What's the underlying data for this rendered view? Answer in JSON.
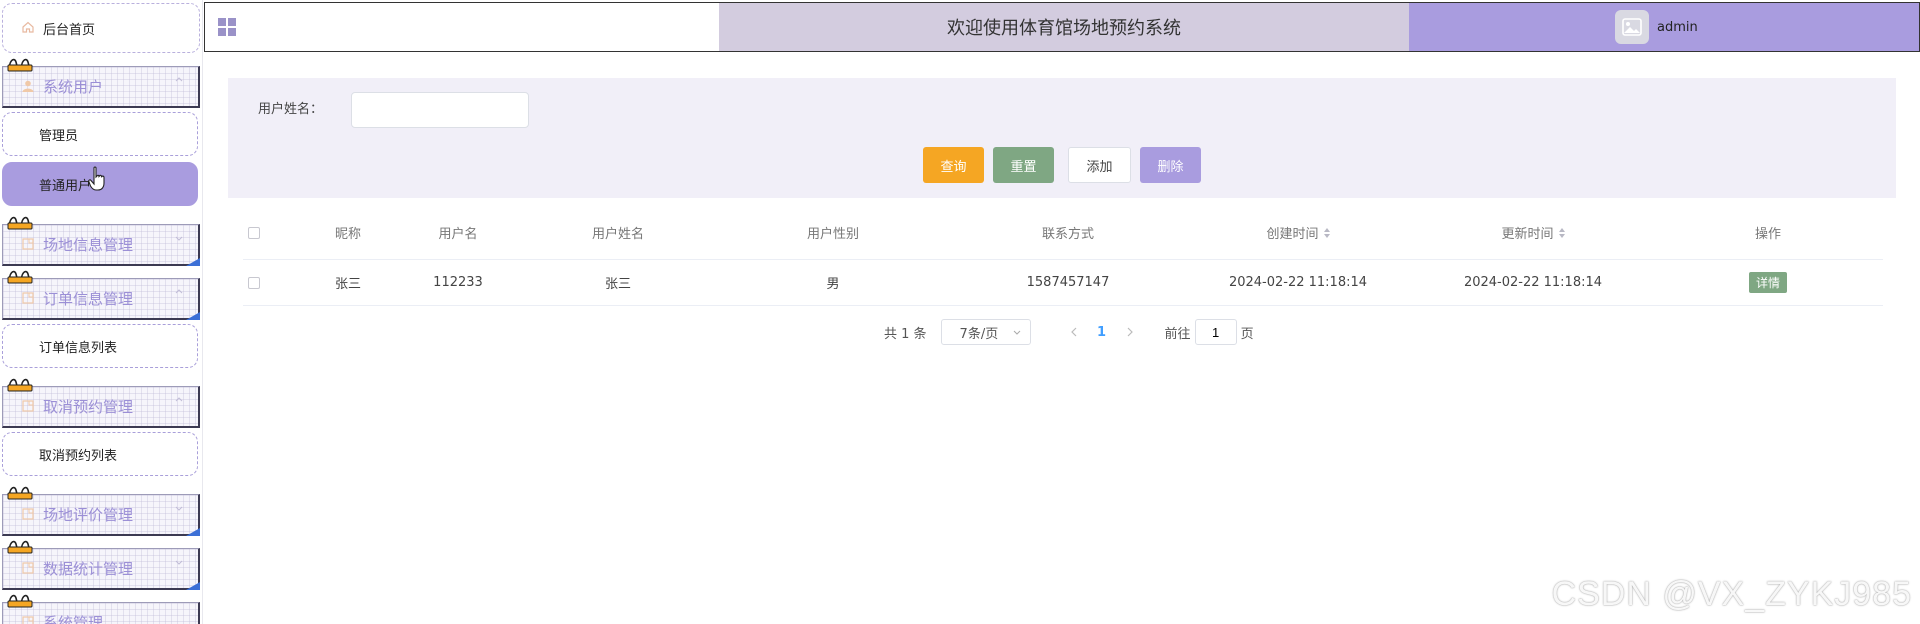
{
  "sidebar": {
    "home": "后台首页",
    "groups": [
      {
        "label": "系统用户"
      },
      {
        "label": "场地信息管理"
      },
      {
        "label": "订单信息管理"
      },
      {
        "label": "取消预约管理"
      },
      {
        "label": "场地评价管理"
      },
      {
        "label": "数据统计管理"
      },
      {
        "label": "系统管理"
      }
    ],
    "subs": {
      "admin": "管理员",
      "normal_user": "普通用户",
      "order_list": "订单信息列表",
      "cancel_list": "取消预约列表"
    }
  },
  "header": {
    "title": "欢迎使用体育馆场地预约系统",
    "username": "admin"
  },
  "search": {
    "label": "用户姓名：",
    "value": "",
    "buttons": {
      "query": "查询",
      "reset": "重置",
      "add": "添加",
      "delete": "删除"
    }
  },
  "table": {
    "headers": [
      "昵称",
      "用户名",
      "用户姓名",
      "用户性别",
      "联系方式",
      "创建时间",
      "更新时间",
      "操作"
    ],
    "rows": [
      {
        "nickname": "张三",
        "username": "112233",
        "realname": "张三",
        "gender": "男",
        "phone": "1587457147",
        "created": "2024-02-22 11:18:14",
        "updated": "2024-02-22 11:18:14",
        "action": "详情"
      }
    ]
  },
  "pagination": {
    "total": "共 1 条",
    "page_size": "7条/页",
    "current": "1",
    "goto_prefix": "前往",
    "goto_value": "1",
    "goto_suffix": "页"
  },
  "watermark": "CSDN @VX_ZYKJ985",
  "colors": {
    "accent": "#a99cdf",
    "query": "#f5a623",
    "reset": "#7fa783",
    "title_bar": "#d3ccdf",
    "panel": "#f1eff8"
  }
}
